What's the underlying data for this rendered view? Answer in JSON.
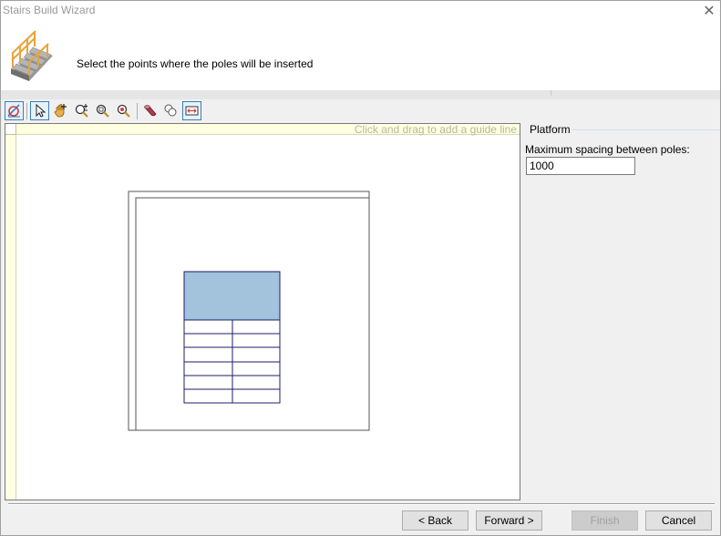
{
  "window": {
    "title": "Stairs Build Wizard",
    "close_glyph": "✕"
  },
  "header": {
    "instruction": "Select the points where the poles will be inserted",
    "icon": "stairs-icon"
  },
  "toolbar": {
    "icons": [
      "guide-line-icon",
      "pointer-icon",
      "pan-hand-icon",
      "zoom-in-out-icon",
      "zoom-window-icon",
      "zoom-extents-icon",
      "add-pole-icon",
      "remove-pole-icon",
      "fit-icon"
    ]
  },
  "canvas": {
    "hint": "Click and drag to add a guide line",
    "highlight_color": "#a3c2dc",
    "line_color": "#1c1c6e"
  },
  "platform": {
    "group_label": "Platform",
    "spacing_label": "Maximum spacing between poles:",
    "spacing_value": "1000"
  },
  "buttons": {
    "back": "< Back",
    "forward": "Forward >",
    "finish": "Finish",
    "cancel": "Cancel"
  }
}
